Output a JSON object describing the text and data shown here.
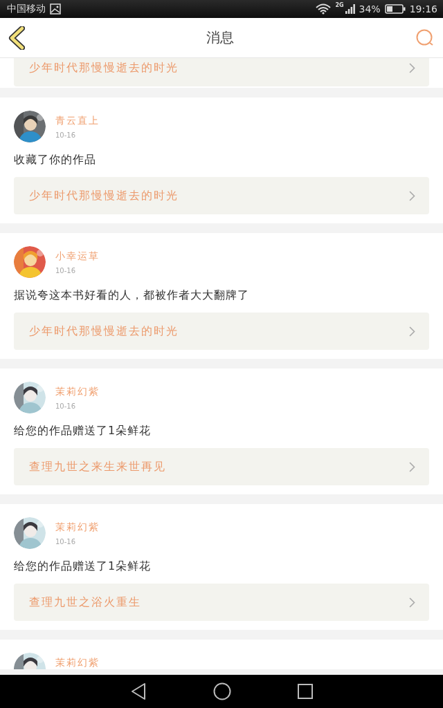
{
  "status_bar": {
    "carrier": "中国移动",
    "network": "2G",
    "battery": "34%",
    "time": "19:16"
  },
  "header": {
    "title": "消息"
  },
  "messages": [
    {
      "kind": "partial",
      "link": "少年时代那慢慢逝去的时光"
    },
    {
      "kind": "full",
      "user": "青云直上",
      "date": "10-16",
      "text": "收藏了你的作品",
      "link": "少年时代那慢慢逝去的时光"
    },
    {
      "kind": "full",
      "user": "小幸运草",
      "date": "10-16",
      "text": "据说夸这本书好看的人，都被作者大大翻牌了",
      "link": "少年时代那慢慢逝去的时光"
    },
    {
      "kind": "full",
      "user": "茉莉幻紫",
      "date": "10-16",
      "text": "给您的作品赠送了1朵鲜花",
      "link": "查理九世之来生来世再见"
    },
    {
      "kind": "full",
      "user": "茉莉幻紫",
      "date": "10-16",
      "text": "给您的作品赠送了1朵鲜花",
      "link": "查理九世之浴火重生"
    },
    {
      "kind": "top",
      "user": "茉莉幻紫"
    }
  ]
}
